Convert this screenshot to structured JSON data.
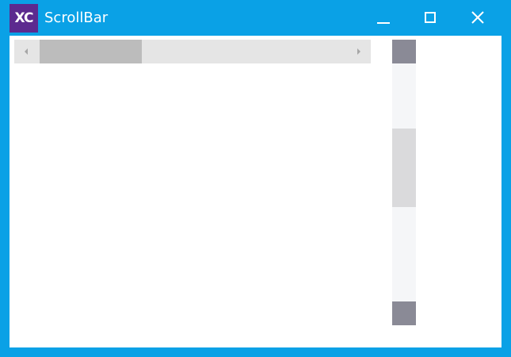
{
  "window": {
    "title": "ScrollBar",
    "logo_text": "XC",
    "frame_color": "#0aa1e6",
    "logo_color": "#5c2a8f",
    "controls": [
      {
        "name": "minimize-button",
        "icon": "minimize-icon"
      },
      {
        "name": "maximize-button",
        "icon": "maximize-icon"
      },
      {
        "name": "close-button",
        "icon": "close-icon"
      }
    ]
  },
  "horizontal_scrollbar": {
    "orientation": "horizontal",
    "track_color": "#e5e5e5",
    "thumb_color": "#bcbcbc",
    "left_arrow_icon": "triangle-left-icon",
    "right_arrow_icon": "triangle-right-icon",
    "thumb_position": 0.0
  },
  "vertical_scrollbar": {
    "orientation": "vertical",
    "track_color": "#f5f6f8",
    "thumb_color": "#dadadc",
    "button_color": "#8a8a96",
    "thumb_position": 0.4
  }
}
